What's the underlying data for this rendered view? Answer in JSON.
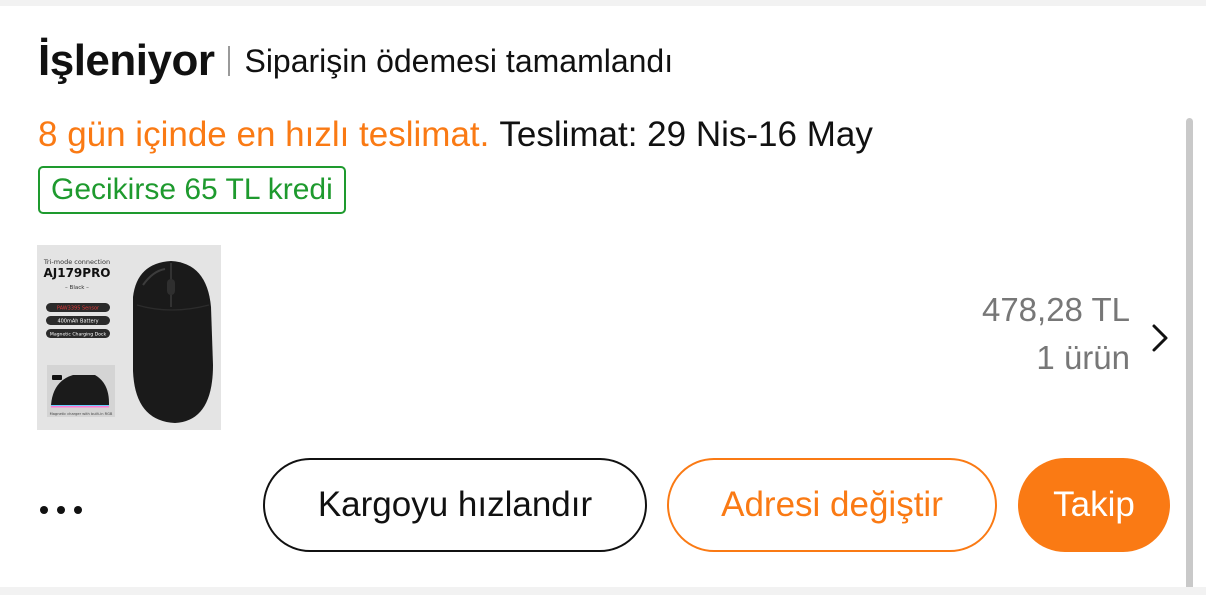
{
  "order": {
    "status_title": "İşleniyor",
    "status_subtitle": "Siparişin ödemesi tamamlandı",
    "delivery_fast": "8 gün içinde en hızlı teslimat.",
    "delivery_range": "Teslimat: 29 Nis-16 May",
    "credit_badge": "Gecikirse 65 TL kredi"
  },
  "product": {
    "image": {
      "connection": "Tri-mode connection",
      "model": "AJ179PRO",
      "color": "– Black –",
      "feature_1": "PAW3395 Sensor",
      "feature_2": "400mAh Battery",
      "feature_3": "Magnetic Charging Dock",
      "dock_note": "Magnetic charger with built-in RGB"
    },
    "price": "478,28 TL",
    "quantity": "1 ürün"
  },
  "actions": {
    "more_icon": "more-horizontal-icon",
    "speed_up_label": "Kargoyu hızlandır",
    "change_address_label": "Adresi değiştir",
    "track_label": "Takip"
  },
  "colors": {
    "accent": "#fa7a14",
    "success": "#1e9a2e",
    "text": "#111111",
    "muted": "#777777"
  }
}
